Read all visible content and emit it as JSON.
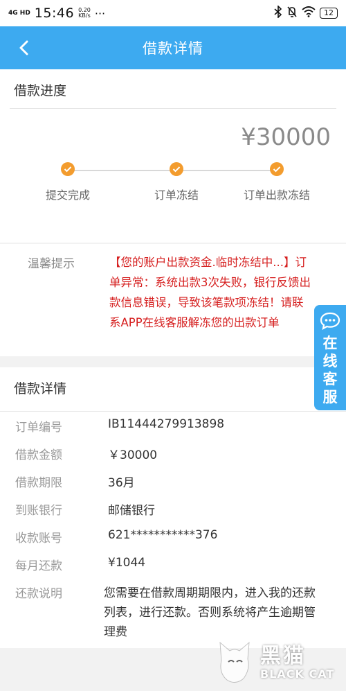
{
  "statusbar": {
    "network": "4G HD",
    "time": "15:46",
    "speed_value": "0.20",
    "speed_unit": "KB/s",
    "more": "···",
    "battery": "12"
  },
  "header": {
    "title": "借款详情"
  },
  "progress": {
    "heading": "借款进度",
    "amount": "¥30000",
    "steps": [
      {
        "label": "提交完成"
      },
      {
        "label": "订单冻结"
      },
      {
        "label": "订单出款冻结"
      }
    ],
    "step_color": "#f39c2e"
  },
  "tip": {
    "label": "温馨提示",
    "text": "【您的账户出款资金.临时冻结中...】订单异常：系统出款3次失败，银行反馈出款信息错误，导致该笔款项冻结！请联系APP在线客服解冻您的出款订单"
  },
  "details": {
    "heading": "借款详情",
    "rows": [
      {
        "key": "订单编号",
        "value": "IB11444279913898"
      },
      {
        "key": "借款金额",
        "value": "￥30000"
      },
      {
        "key": "借款期限",
        "value": "36月"
      },
      {
        "key": "到账银行",
        "value": "邮储银行"
      },
      {
        "key": "收款账号",
        "value": "621***********376"
      },
      {
        "key": "每月还款",
        "value": "¥1044"
      }
    ],
    "note": {
      "key": "还款说明",
      "value": "您需要在借款周期期限内，进入我的还款列表，进行还款。否则系统将产生逾期管理费"
    }
  },
  "service": {
    "label": "在线客服"
  },
  "watermark": {
    "cn": "黑猫",
    "en": "BLACK CAT"
  },
  "colors": {
    "accent": "#3daaf0",
    "warning": "#d62020"
  }
}
